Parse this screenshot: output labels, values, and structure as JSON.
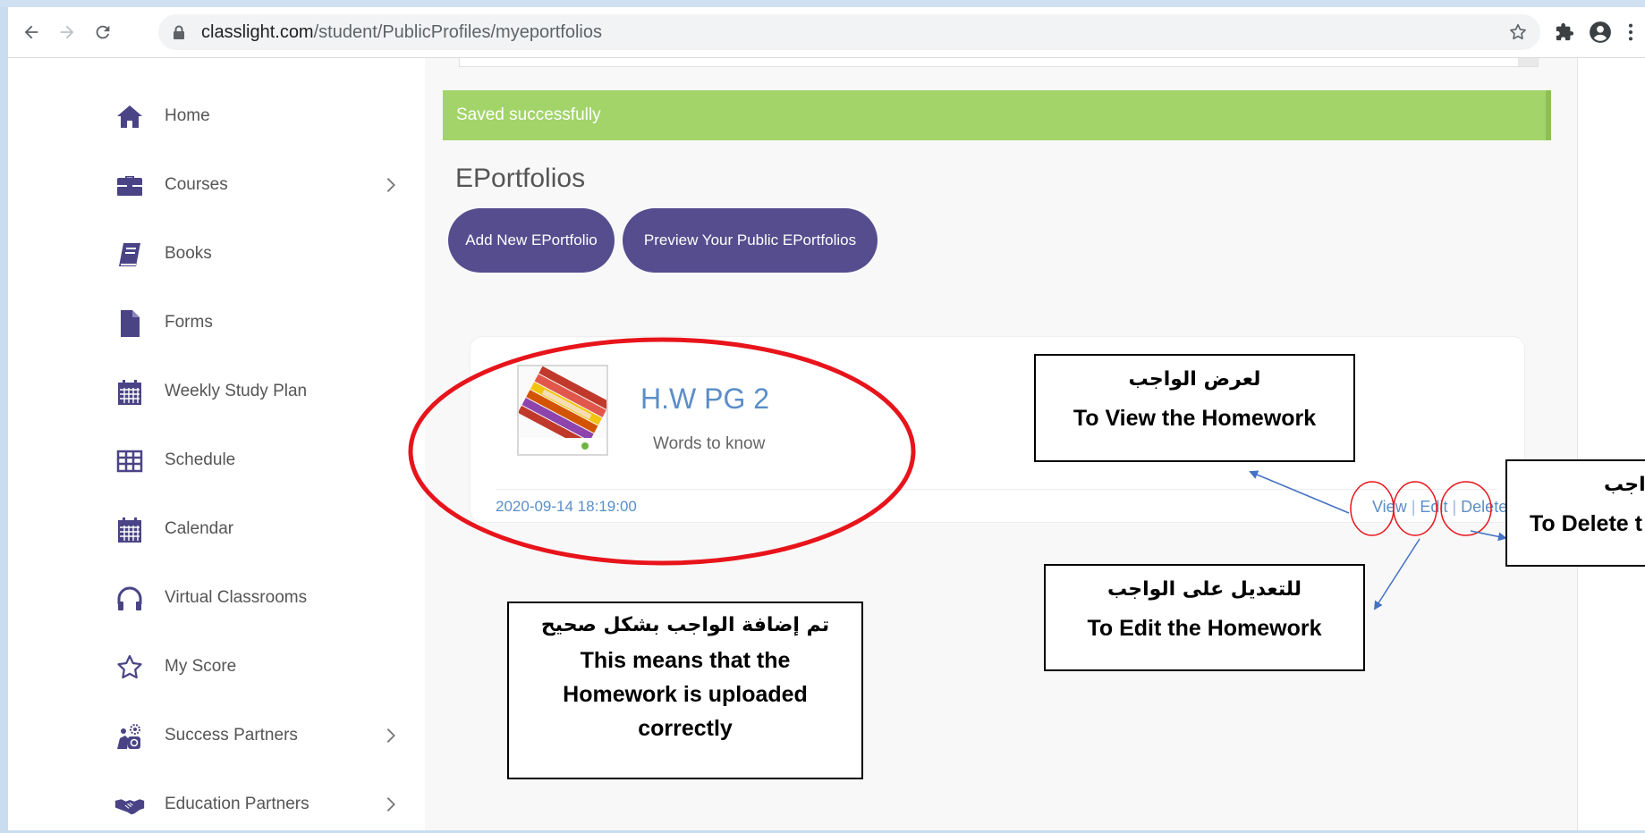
{
  "browser": {
    "url_host": "classlight.com",
    "url_path": "/student/PublicProfiles/myeportfolios"
  },
  "sidebar": {
    "items": [
      {
        "label": "Home",
        "icon": "home-icon",
        "has_submenu": false
      },
      {
        "label": "Courses",
        "icon": "briefcase-icon",
        "has_submenu": true
      },
      {
        "label": "Books",
        "icon": "book-icon",
        "has_submenu": false
      },
      {
        "label": "Forms",
        "icon": "document-icon",
        "has_submenu": false
      },
      {
        "label": "Weekly Study Plan",
        "icon": "calendar-grid-icon",
        "has_submenu": false
      },
      {
        "label": "Schedule",
        "icon": "table-icon",
        "has_submenu": false
      },
      {
        "label": "Calendar",
        "icon": "calendar-icon",
        "has_submenu": false
      },
      {
        "label": "Virtual Classrooms",
        "icon": "headphones-icon",
        "has_submenu": false
      },
      {
        "label": "My Score",
        "icon": "star-icon",
        "has_submenu": false
      },
      {
        "label": "Success Partners",
        "icon": "gears-icon",
        "has_submenu": true
      },
      {
        "label": "Education Partners",
        "icon": "handshake-icon",
        "has_submenu": true
      }
    ]
  },
  "alert": {
    "text": "Saved successfully",
    "color": "#a2d46a"
  },
  "main": {
    "heading": "EPortfolios",
    "add_button": "Add New EPortfolio",
    "preview_button": "Preview Your Public EPortfolios",
    "button_color": "#564d8f"
  },
  "portfolio": {
    "title": "H.W PG 2",
    "subtitle": "Words to know",
    "date": "2020-09-14 18:19:00",
    "actions": {
      "view": "View",
      "edit": "Edit",
      "delete": "Delete",
      "separator": "|"
    }
  },
  "annotations": {
    "view_box": {
      "arabic": "لعرض الواجب",
      "english": "To View the Homework"
    },
    "edit_box": {
      "arabic": "للتعديل على الواجب",
      "english": "To Edit the Homework"
    },
    "delete_box": {
      "arabic": "اجب",
      "english": "To Delete t"
    },
    "success_box": {
      "arabic": "تم إضافة الواجب بشكل صحيح",
      "english": "This means that the Homework is uploaded correctly"
    },
    "highlight_color": "#e8141b",
    "arrow_color": "#4472c4"
  }
}
